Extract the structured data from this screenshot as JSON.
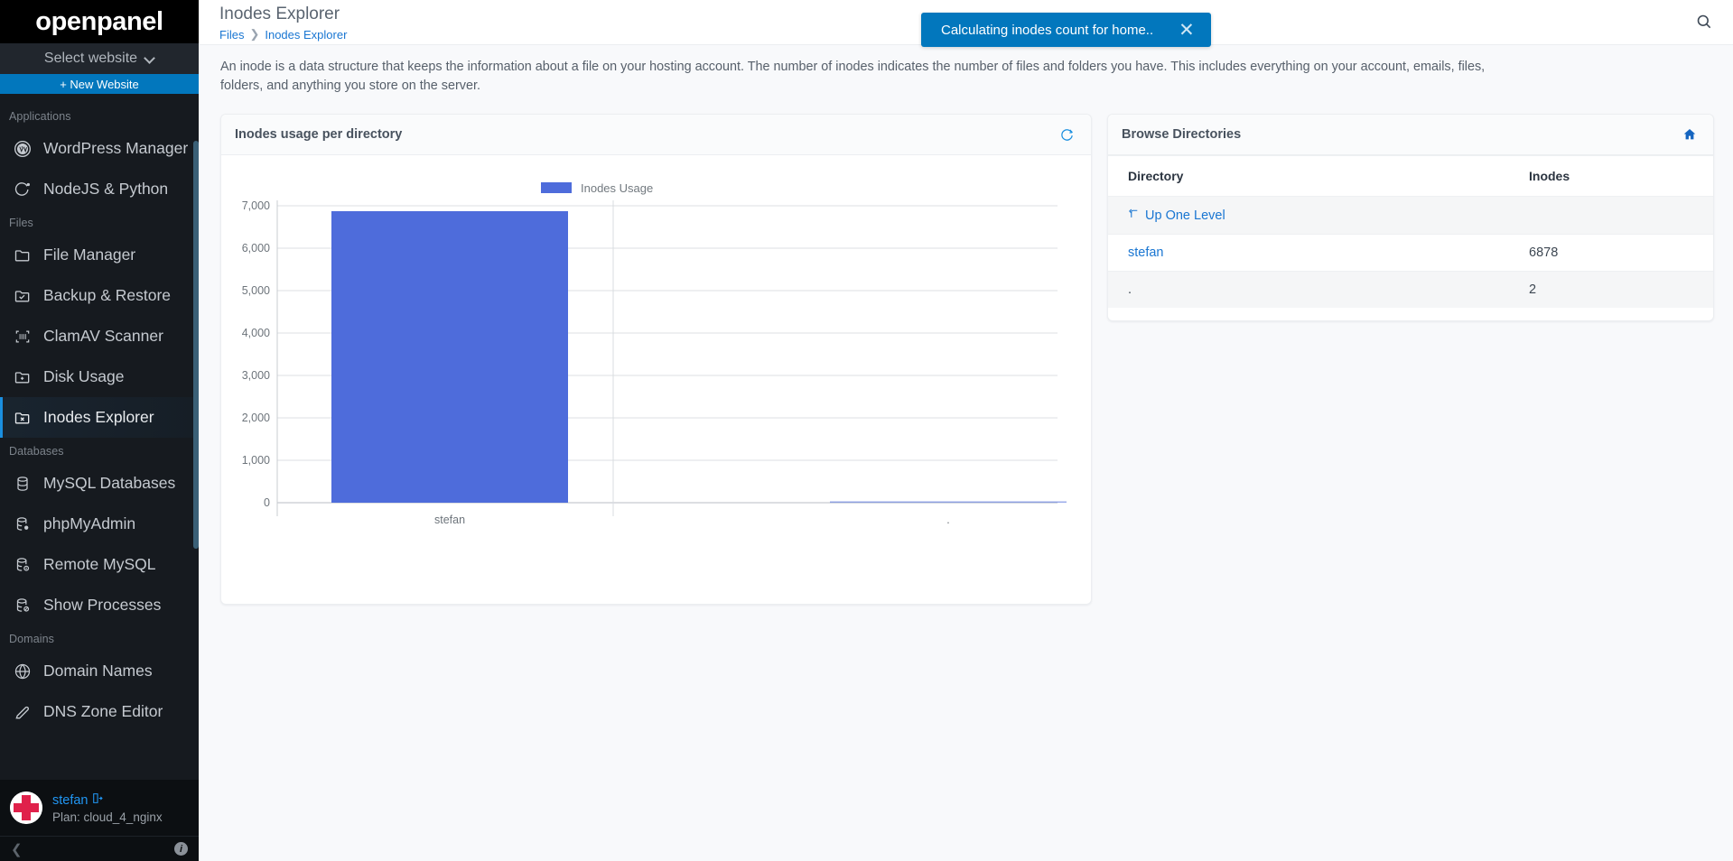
{
  "brand": {
    "name": "openpanel"
  },
  "sidebar": {
    "site_select_label": "Select website",
    "new_website_label": "+ New Website",
    "groups": [
      {
        "title": "Applications",
        "items": [
          {
            "label": "WordPress Manager",
            "icon": "wordpress-icon",
            "active": false
          },
          {
            "label": "NodeJS & Python",
            "icon": "nodejs-icon",
            "active": false
          }
        ]
      },
      {
        "title": "Files",
        "items": [
          {
            "label": "File Manager",
            "icon": "folder-icon",
            "active": false
          },
          {
            "label": "Backup & Restore",
            "icon": "folder-check-icon",
            "active": false
          },
          {
            "label": "ClamAV Scanner",
            "icon": "scan-icon",
            "active": false
          },
          {
            "label": "Disk Usage",
            "icon": "folder-plus-icon",
            "active": false
          },
          {
            "label": "Inodes Explorer",
            "icon": "folder-x-icon",
            "active": true
          }
        ]
      },
      {
        "title": "Databases",
        "items": [
          {
            "label": "MySQL Databases",
            "icon": "database-icon",
            "active": false
          },
          {
            "label": "phpMyAdmin",
            "icon": "database-gear-icon",
            "active": false
          },
          {
            "label": "Remote MySQL",
            "icon": "database-info-icon",
            "active": false
          },
          {
            "label": "Show Processes",
            "icon": "database-block-icon",
            "active": false
          }
        ]
      },
      {
        "title": "Domains",
        "items": [
          {
            "label": "Domain Names",
            "icon": "globe-icon",
            "active": false
          },
          {
            "label": "DNS Zone Editor",
            "icon": "edit-icon",
            "active": false
          }
        ]
      }
    ],
    "user": {
      "name": "stefan",
      "logout_icon": "logout-icon",
      "plan": "Plan: cloud_4_nginx",
      "avatar_icon": "avatar-identicon"
    },
    "footer": {
      "collapse_icon": "chevron-left-icon",
      "info_icon": "info-icon"
    }
  },
  "header": {
    "title": "Inodes Explorer",
    "breadcrumb": [
      "Files",
      "Inodes Explorer"
    ],
    "breadcrumb_separator": "❯",
    "search_icon": "search-icon"
  },
  "toast": {
    "message": "Calculating inodes count for home..",
    "close_icon": "close-icon",
    "color": "#0277bd"
  },
  "intro": {
    "text": "An inode is a data structure that keeps the information about a file on your hosting account. The number of inodes indicates the number of files and folders you have. This includes everything on your account, emails, files, folders, and anything you store on the server."
  },
  "chart_card": {
    "title": "Inodes usage per directory",
    "refresh_icon": "refresh-icon",
    "refresh_icon_color": "#1a8fe0"
  },
  "chart_data": {
    "type": "bar",
    "title": "Inodes usage per directory",
    "categories": [
      "stefan",
      "."
    ],
    "values": [
      6878,
      2
    ],
    "series": [
      {
        "name": "Inodes Usage",
        "values": [
          6878,
          2
        ]
      }
    ],
    "legend": [
      "Inodes Usage"
    ],
    "legend_position": "top",
    "legend_color": "#4e6cdb",
    "bar_color": "#4e6cdb",
    "xlabel": "",
    "ylabel": "",
    "ylim": [
      0,
      7000
    ],
    "yticks": [
      0,
      1000,
      2000,
      3000,
      4000,
      5000,
      6000,
      7000
    ],
    "ytick_labels": [
      "0",
      "1,000",
      "2,000",
      "3,000",
      "4,000",
      "5,000",
      "6,000",
      "7,000"
    ],
    "grid": true
  },
  "dir_card": {
    "title": "Browse Directories",
    "home_icon": "home-icon",
    "home_icon_color": "#1565c0",
    "columns": [
      "Directory",
      "Inodes"
    ],
    "up_one_level": {
      "label": "Up One Level",
      "icon": "arrow-up-left-icon"
    },
    "rows": [
      {
        "directory": "stefan",
        "inodes": "6878",
        "is_link": true
      },
      {
        "directory": ".",
        "inodes": "2",
        "is_link": false
      }
    ]
  }
}
